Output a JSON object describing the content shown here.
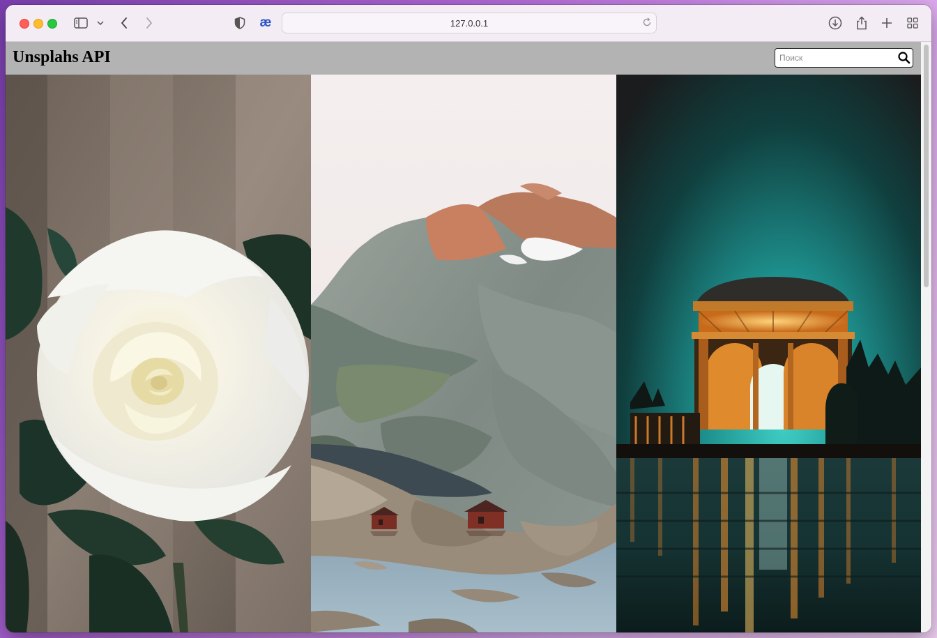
{
  "browser": {
    "url": "127.0.0.1",
    "icons": [
      "sidebar-icon",
      "chevron-down-icon",
      "back-icon",
      "forward-icon",
      "shield-icon",
      "ae-extension-icon",
      "reload-icon",
      "download-icon",
      "share-icon",
      "new-tab-icon",
      "tab-overview-icon"
    ],
    "extension_label": "æ"
  },
  "page": {
    "title": "Unsplahs API",
    "search": {
      "placeholder": "Поиск",
      "value": ""
    },
    "colors": {
      "header_bg": "#b3b3b3"
    },
    "photos": [
      {
        "subject": "white rose"
      },
      {
        "subject": "mountain lake with cabins"
      },
      {
        "subject": "illuminated rotunda at night"
      }
    ]
  }
}
